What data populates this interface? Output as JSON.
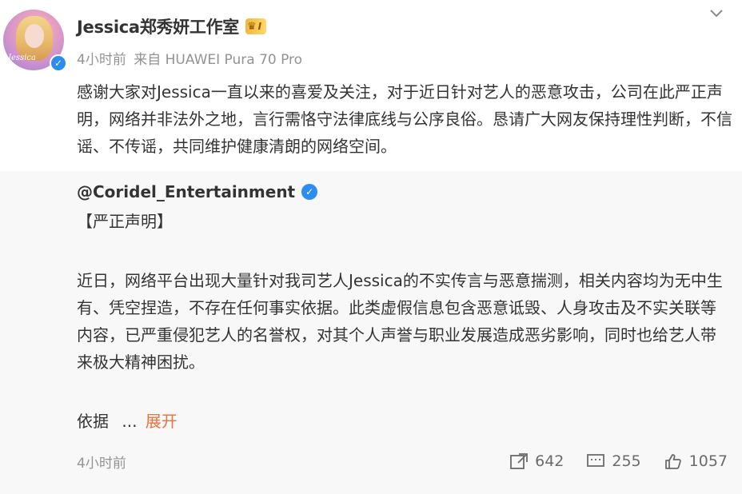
{
  "author": {
    "name": "Jessica郑秀妍工作室",
    "badge_level": "I",
    "avatar_script": "Jessica"
  },
  "meta": {
    "time": "4小时前",
    "source": "来自 HUAWEI Pura 70 Pro"
  },
  "post_text": "感谢大家对Jessica一直以来的喜爱及关注，对于近日针对艺人的恶意攻击，公司在此严正声明，网络并非法外之地，言行需恪守法律底线与公序良俗。恳请广大网友保持理性判断，不信谣、不传谣，共同维护健康清朗的网络空间。",
  "repost": {
    "author": "@Coridel_Entertainment",
    "title": "【严正声明】",
    "body": "近日，网络平台出现大量针对我司艺人Jessica的不实传言与恶意揣测，相关内容均为无中生有、凭空捏造，不存在任何事实依据。此类虚假信息包含恶意诋毁、人身攻击及不实关联等内容，已严重侵犯艺人的名誉权，对其个人声誉与职业发展造成恶劣影响，同时也给艺人带来极大精神困扰。",
    "more_prefix": "依据",
    "ellipsis": "...",
    "expand_label": "展开"
  },
  "footer": {
    "time": "4小时前",
    "repost_count": "642",
    "comment_count": "255",
    "like_count": "1057"
  },
  "colors": {
    "accent_link": "#eb7340",
    "verified_blue": "#2d8cf0",
    "muted": "#939393"
  }
}
